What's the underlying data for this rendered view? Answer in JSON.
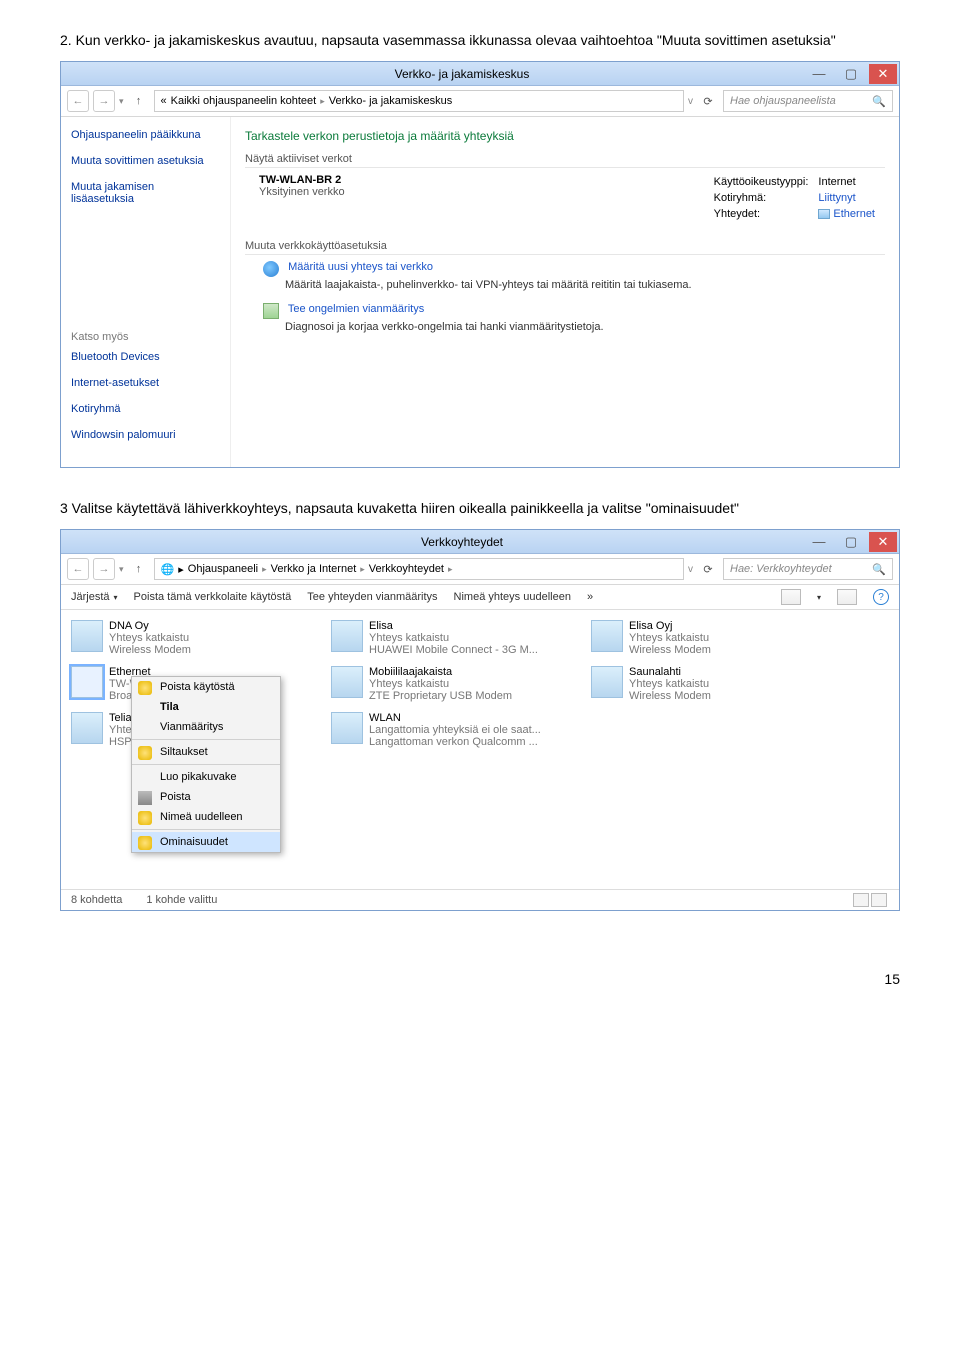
{
  "page": {
    "step2_text": "2. Kun verkko- ja jakamiskeskus avautuu, napsauta vasemmassa ikkunassa olevaa vaihtoehtoa \"Muuta sovittimen asetuksia\"",
    "step3_text": "3 Valitse käytettävä lähiverkkoyhteys, napsauta kuvaketta hiiren oikealla painikkeella ja valitse \"ominaisuudet\"",
    "page_number": "15"
  },
  "win1": {
    "title": "Verkko- ja jakamiskeskus",
    "breadcrumb": {
      "p1": "Kaikki ohjauspaneelin kohteet",
      "p2": "Verkko- ja jakamiskeskus"
    },
    "search_placeholder": "Hae ohjauspaneelista",
    "sidebar": {
      "link0": "Ohjauspaneelin pääikkuna",
      "link1": "Muuta sovittimen asetuksia",
      "link2": "Muuta jakamisen lisäasetuksia",
      "see_also_heading": "Katso myös",
      "sa0": "Bluetooth Devices",
      "sa1": "Internet-asetukset",
      "sa2": "Kotiryhmä",
      "sa3": "Windowsin palomuuri"
    },
    "main": {
      "heading": "Tarkastele verkon perustietoja ja määritä yhteyksiä",
      "active_heading": "Näytä aktiiviset verkot",
      "net": {
        "name": "TW-WLAN-BR 2",
        "type": "Yksityinen verkko",
        "row1k": "Käyttöoikeustyyppi:",
        "row1v": "Internet",
        "row2k": "Kotiryhmä:",
        "row2v": "Liittynyt",
        "row3k": "Yhteydet:",
        "row3v": "Ethernet"
      },
      "change_heading": "Muuta verkkokäyttöasetuksia",
      "action1_title": "Määritä uusi yhteys tai verkko",
      "action1_desc": "Määritä laajakaista-, puhelinverkko- tai VPN-yhteys tai määritä reititin tai tukiasema.",
      "action2_title": "Tee ongelmien vianmääritys",
      "action2_desc": "Diagnosoi ja korjaa verkko-ongelmia tai hanki vianmääritystietoja."
    }
  },
  "win2": {
    "title": "Verkkoyhteydet",
    "breadcrumb": {
      "p1": "Ohjauspaneeli",
      "p2": "Verkko ja Internet",
      "p3": "Verkkoyhteydet"
    },
    "search_placeholder": "Hae: Verkkoyhteydet",
    "toolbar": {
      "b0": "Järjestä",
      "b1": "Poista tämä verkkolaite käytöstä",
      "b2": "Tee yhteyden vianmääritys",
      "b3": "Nimeä yhteys uudelleen",
      "more": "»"
    },
    "connections": [
      {
        "name": "DNA Oy",
        "l2": "Yhteys katkaistu",
        "l3": "Wireless Modem"
      },
      {
        "name": "Elisa",
        "l2": "Yhteys katkaistu",
        "l3": "HUAWEI Mobile Connect - 3G M..."
      },
      {
        "name": "Elisa Oyj",
        "l2": "Yhteys katkaistu",
        "l3": "Wireless Modem"
      },
      {
        "name": "Ethernet",
        "l2": "TW-WLAN",
        "l3": "Broadcom"
      },
      {
        "name": "Mobiililaajakaista",
        "l2": "Yhteys katkaistu",
        "l3": "ZTE Proprietary USB Modem"
      },
      {
        "name": "Saunalahti",
        "l2": "Yhteys katkaistu",
        "l3": "Wireless Modem"
      },
      {
        "name": "TeliaSonera",
        "l2": "Yhteys ka",
        "l3": "HSPADat"
      },
      {
        "name": "WLAN",
        "l2": "Langattomia yhteyksiä ei ole saat...",
        "l3": "Langattoman verkon Qualcomm ..."
      }
    ],
    "ctx": {
      "m0": "Poista käytöstä",
      "m1": "Tila",
      "m2": "Vianmääritys",
      "m3": "Siltaukset",
      "m4": "Luo pikakuvake",
      "m5": "Poista",
      "m6": "Nimeä uudelleen",
      "m7": "Ominaisuudet"
    },
    "status": {
      "s0": "8 kohdetta",
      "s1": "1 kohde valittu"
    }
  }
}
